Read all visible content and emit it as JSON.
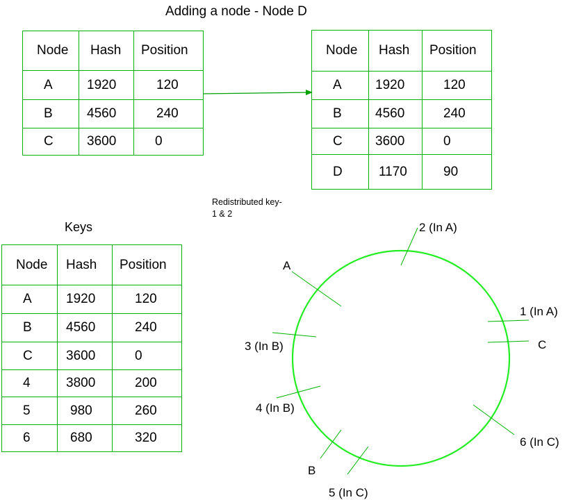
{
  "title": "Adding a node - Node D",
  "note_lines": [
    "Redistributed key-",
    "1 & 2"
  ],
  "keys_title": "Keys",
  "columns": [
    "Node",
    "Hash",
    "Position"
  ],
  "table_before": [
    [
      "A",
      "1920",
      "120"
    ],
    [
      "B",
      "4560",
      "240"
    ],
    [
      "C",
      "3600",
      "0"
    ]
  ],
  "table_after": [
    [
      "A",
      "1920",
      "120"
    ],
    [
      "B",
      "4560",
      "240"
    ],
    [
      "C",
      "3600",
      "0"
    ],
    [
      "D",
      "1170",
      "90"
    ]
  ],
  "table_keys": [
    [
      "A",
      "1920",
      "120"
    ],
    [
      "B",
      "4560",
      "240"
    ],
    [
      "C",
      "3600",
      "0"
    ],
    [
      "4",
      "3800",
      "200"
    ],
    [
      "5",
      "980",
      "260"
    ],
    [
      "6",
      "680",
      "320"
    ]
  ],
  "ring_labels": {
    "a": "A",
    "k2": "2 (In A)",
    "k1": "1 (In A)",
    "c": "C",
    "k3": "3 (In B)",
    "k4": "4 (In B)",
    "k6": "6 (In C)",
    "b": "B",
    "k5": "5 (In C)"
  },
  "colors": {
    "border": "#00b300",
    "ring": "#22ee22",
    "arrow": "#00a000"
  }
}
